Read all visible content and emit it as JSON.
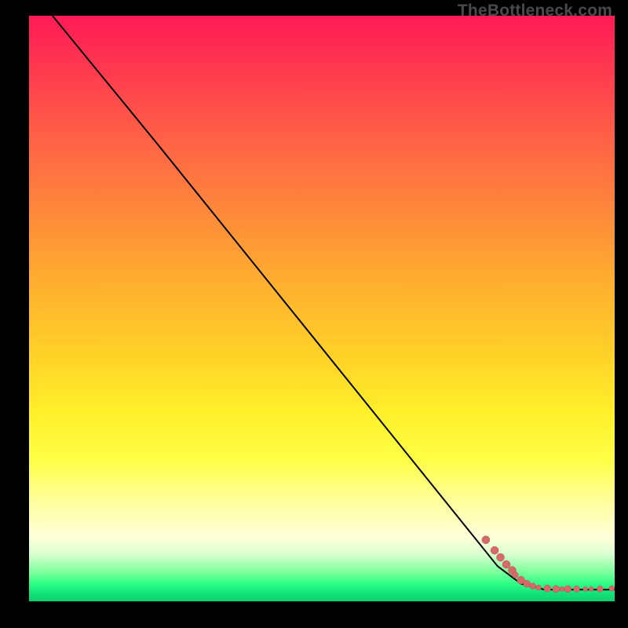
{
  "attribution": "TheBottleneck.com",
  "chart_data": {
    "type": "line",
    "xlim": [
      0,
      100
    ],
    "ylim": [
      0,
      100
    ],
    "title": "",
    "xlabel": "",
    "ylabel": "",
    "line_series": {
      "name": "curve",
      "points": [
        {
          "x": 4,
          "y": 100
        },
        {
          "x": 22,
          "y": 78
        },
        {
          "x": 80,
          "y": 6
        },
        {
          "x": 84,
          "y": 3
        },
        {
          "x": 88,
          "y": 2
        },
        {
          "x": 100,
          "y": 2
        }
      ]
    },
    "scatter_series": {
      "name": "points",
      "points": [
        {
          "x": 78,
          "y": 10.5,
          "r": 5
        },
        {
          "x": 79.5,
          "y": 8.7,
          "r": 5
        },
        {
          "x": 80.5,
          "y": 7.5,
          "r": 5
        },
        {
          "x": 81.5,
          "y": 6.3,
          "r": 5
        },
        {
          "x": 82.5,
          "y": 5.3,
          "r": 5
        },
        {
          "x": 83,
          "y": 4.5,
          "r": 4
        },
        {
          "x": 84,
          "y": 3.6,
          "r": 5
        },
        {
          "x": 85,
          "y": 3.0,
          "r": 4.5
        },
        {
          "x": 86,
          "y": 2.6,
          "r": 4
        },
        {
          "x": 87,
          "y": 2.35,
          "r": 3.5
        },
        {
          "x": 88.5,
          "y": 2.2,
          "r": 4.5
        },
        {
          "x": 90,
          "y": 2.1,
          "r": 4.5
        },
        {
          "x": 91,
          "y": 2.1,
          "r": 3
        },
        {
          "x": 92,
          "y": 2.1,
          "r": 4.5
        },
        {
          "x": 93.5,
          "y": 2.1,
          "r": 4
        },
        {
          "x": 95,
          "y": 2.1,
          "r": 3
        },
        {
          "x": 96,
          "y": 2.1,
          "r": 3
        },
        {
          "x": 97.5,
          "y": 2.1,
          "r": 4
        },
        {
          "x": 99.5,
          "y": 2.2,
          "r": 3.5
        }
      ]
    },
    "color_scale": {
      "top": "#ff1a56",
      "mid": "#ffe030",
      "bottom": "#0bcf6f"
    }
  }
}
